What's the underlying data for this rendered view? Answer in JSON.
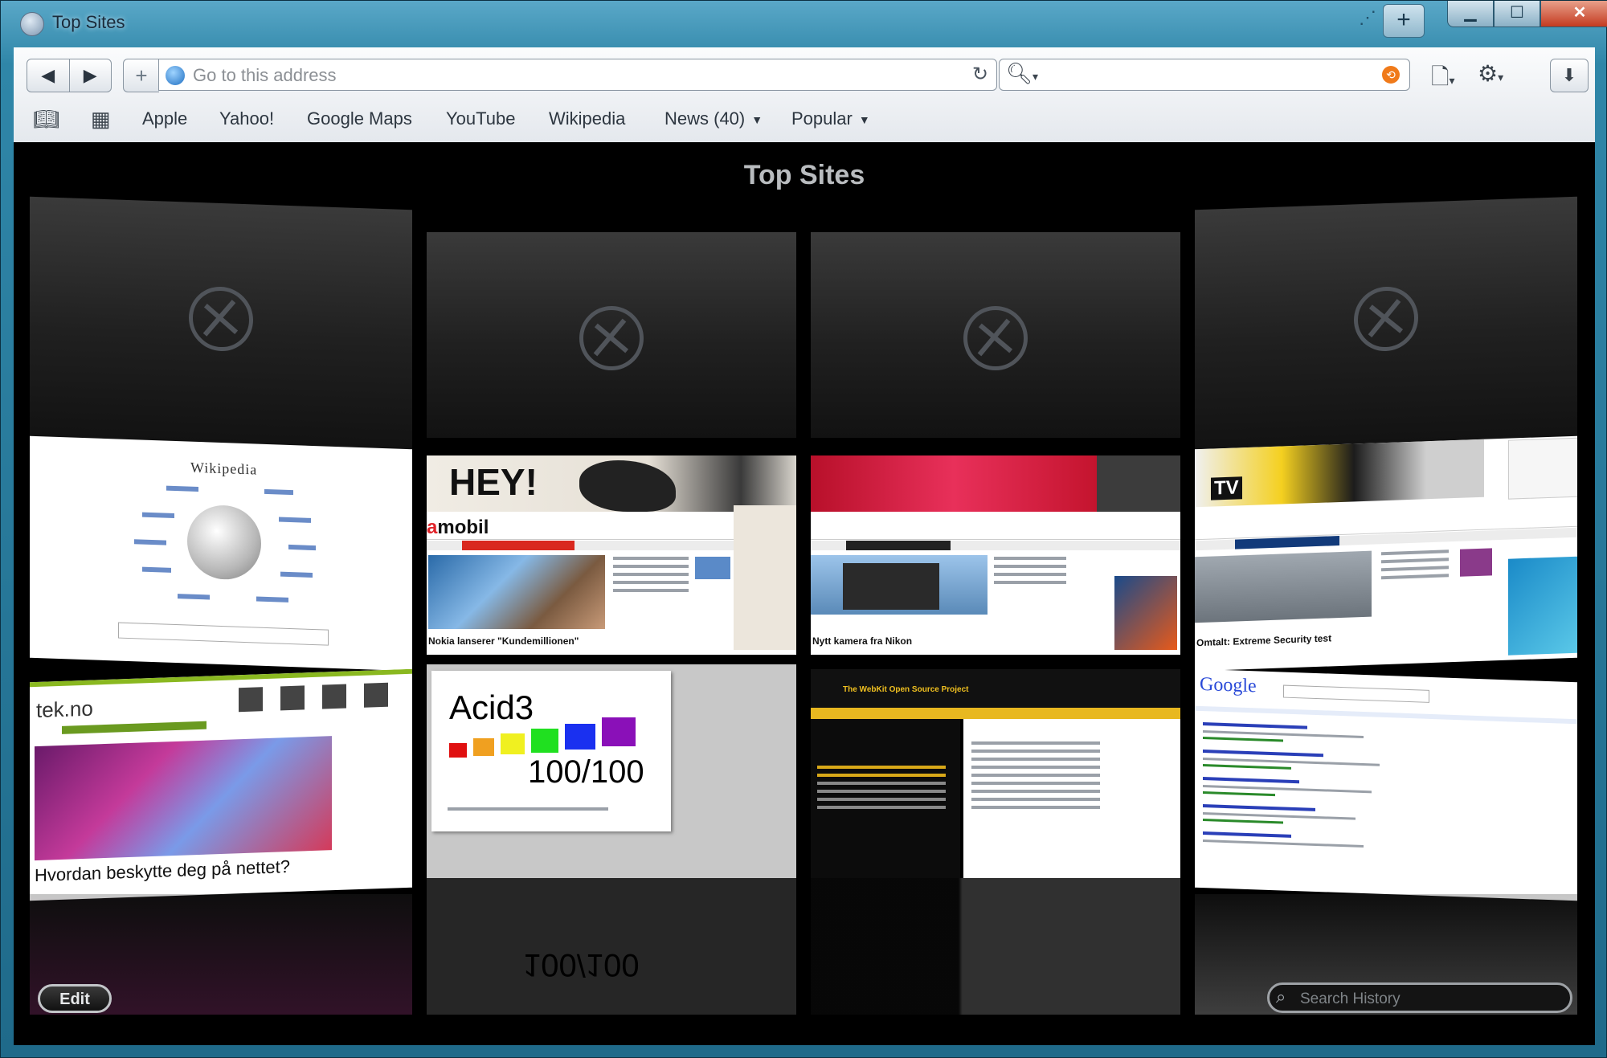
{
  "window": {
    "title": "Top Sites"
  },
  "toolbar": {
    "back_icon": "back-arrow-icon",
    "forward_icon": "forward-arrow-icon",
    "address_placeholder": "Go to this address",
    "search_value": ""
  },
  "bookmarks": {
    "items": [
      {
        "label": "Apple"
      },
      {
        "label": "Yahoo!"
      },
      {
        "label": "Google Maps"
      },
      {
        "label": "YouTube"
      },
      {
        "label": "Wikipedia"
      },
      {
        "label": "News (40)"
      },
      {
        "label": "Popular"
      }
    ]
  },
  "topsites": {
    "title": "Top Sites",
    "edit_label": "Edit",
    "history_placeholder": "Search History"
  },
  "thumbnails": {
    "wiki_logo": "Wikipedia",
    "hey_banner": "HEY!",
    "amobil_brand": "amobil",
    "tekno_brand": "tek.no",
    "tekno_headline": "Hvordan beskytte deg på nettet?",
    "acid_title": "Acid3",
    "acid_score": "100/100",
    "webkit_heading": "The WebKit Open Source Project",
    "google_logo": "Google"
  },
  "colors": {
    "titlebar": "#2f86a8",
    "content_bg": "#000000",
    "close_button": "#c43a20"
  }
}
